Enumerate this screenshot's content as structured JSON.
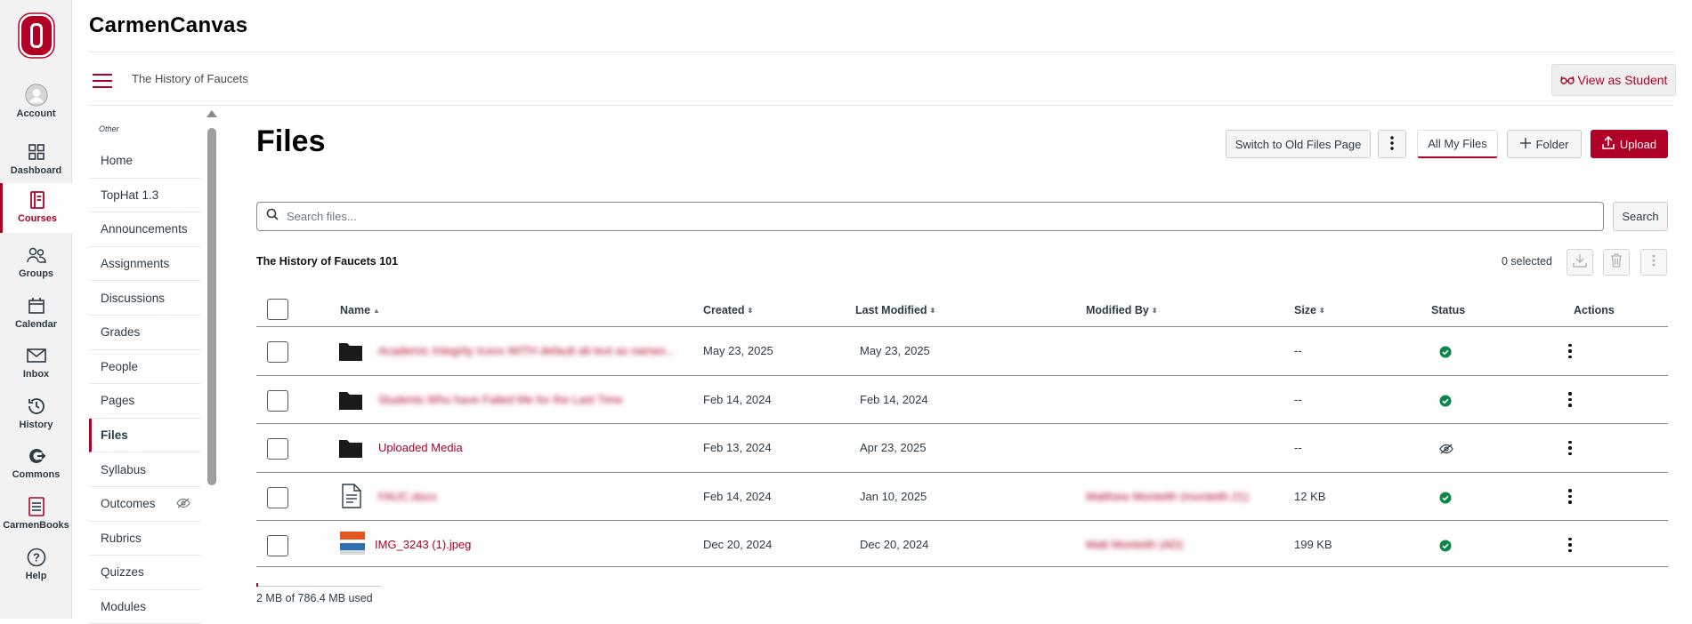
{
  "app": {
    "title": "CarmenCanvas"
  },
  "global_nav": {
    "items": [
      {
        "label": "Account",
        "icon": "avatar-icon"
      },
      {
        "label": "Dashboard",
        "icon": "dashboard-icon"
      },
      {
        "label": "Courses",
        "icon": "courses-icon",
        "active": true
      },
      {
        "label": "Groups",
        "icon": "groups-icon"
      },
      {
        "label": "Calendar",
        "icon": "calendar-icon"
      },
      {
        "label": "Inbox",
        "icon": "inbox-icon"
      },
      {
        "label": "History",
        "icon": "history-icon"
      },
      {
        "label": "Commons",
        "icon": "commons-icon"
      },
      {
        "label": "CarmenBooks",
        "icon": "carmenbooks-icon"
      },
      {
        "label": "Help",
        "icon": "help-icon"
      }
    ]
  },
  "header": {
    "breadcrumb": "The History of Faucets",
    "view_as_student": "View as Student"
  },
  "course_nav": {
    "section_label": "Other",
    "items": [
      {
        "label": "Home"
      },
      {
        "label": "TopHat 1.3"
      },
      {
        "label": "Announcements"
      },
      {
        "label": "Assignments"
      },
      {
        "label": "Discussions"
      },
      {
        "label": "Grades"
      },
      {
        "label": "People"
      },
      {
        "label": "Pages"
      },
      {
        "label": "Files",
        "active": true
      },
      {
        "label": "Syllabus"
      },
      {
        "label": "Outcomes",
        "hidden_icon": "eye-slash-icon"
      },
      {
        "label": "Rubrics"
      },
      {
        "label": "Quizzes"
      },
      {
        "label": "Modules"
      }
    ]
  },
  "main": {
    "title": "Files",
    "buttons": {
      "switch_old": "Switch to Old Files Page",
      "all_my_files": "All My Files",
      "folder": "Folder",
      "upload": "Upload"
    },
    "search": {
      "placeholder": "Search files...",
      "button": "Search"
    },
    "section_title": "The History of Faucets 101",
    "selected_count": "0 selected",
    "table": {
      "columns": [
        "Name",
        "Created",
        "Last Modified",
        "Modified By",
        "Size",
        "Status",
        "Actions"
      ],
      "rows": [
        {
          "name": "Academic Integrity Icons WITH default alt text as names...",
          "type": "folder",
          "created": "May 23, 2025",
          "modified": "May 23, 2025",
          "modified_by": "",
          "size": "--",
          "status": "published",
          "blurred": true
        },
        {
          "name": "Students Who have Failed Me for the Last Time",
          "type": "folder",
          "created": "Feb 14, 2024",
          "modified": "Feb 14, 2024",
          "modified_by": "",
          "size": "--",
          "status": "published",
          "blurred": true
        },
        {
          "name": "Uploaded Media",
          "type": "folder",
          "created": "Feb 13, 2024",
          "modified": "Apr 23, 2025",
          "modified_by": "",
          "size": "--",
          "status": "hidden",
          "blurred": false
        },
        {
          "name": "FAUC.docx",
          "type": "document",
          "created": "Feb 14, 2024",
          "modified": "Jan 10, 2025",
          "modified_by": "Matthew Monteith (monteith.21)",
          "size": "12 KB",
          "status": "published",
          "blurred": true
        },
        {
          "name": "IMG_3243 (1).jpeg",
          "type": "image",
          "created": "Dec 20, 2024",
          "modified": "Dec 20, 2024",
          "modified_by": "Matt Monteith (AD)",
          "size": "199 KB",
          "status": "published",
          "blurred": false
        }
      ]
    },
    "quota": {
      "text": "2 MB of 786.4 MB used",
      "used_fraction": 0.0025
    }
  },
  "colors": {
    "brand": "#b00026",
    "success": "#0b874b",
    "text": "#2d3b45"
  }
}
